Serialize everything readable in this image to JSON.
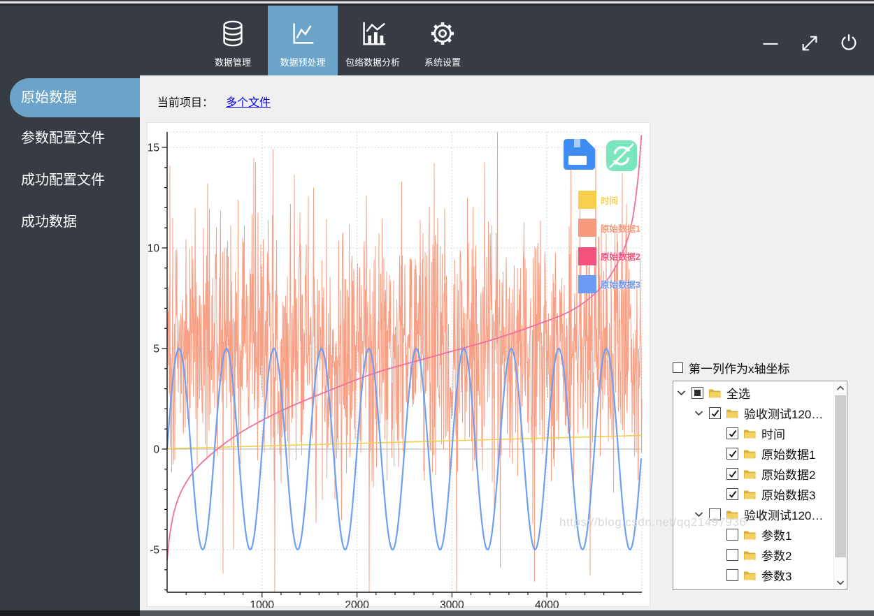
{
  "toolbar": {
    "tabs": [
      {
        "label": "数据管理",
        "selected": false
      },
      {
        "label": "数据预处理",
        "selected": true
      },
      {
        "label": "包络数据分析",
        "selected": false
      },
      {
        "label": "系统设置",
        "selected": false
      }
    ],
    "selected_color": "#6ca3c9"
  },
  "sidebar": {
    "items": [
      {
        "label": "原始数据",
        "selected": true
      },
      {
        "label": "参数配置文件",
        "selected": false
      },
      {
        "label": "成功配置文件",
        "selected": false
      },
      {
        "label": "成功数据",
        "selected": false
      }
    ]
  },
  "main": {
    "project_label": "当前项目：",
    "project_link": "多个文件"
  },
  "right_panel": {
    "checkbox_label": "第一列作为x轴坐标",
    "checkbox_checked": false,
    "tree": [
      {
        "level": 0,
        "expander": true,
        "state": "partial",
        "label": "全选"
      },
      {
        "level": 1,
        "expander": true,
        "state": "checked",
        "label": "验收测试120…"
      },
      {
        "level": 2,
        "expander": false,
        "state": "checked",
        "label": "时间"
      },
      {
        "level": 2,
        "expander": false,
        "state": "checked",
        "label": "原始数据1"
      },
      {
        "level": 2,
        "expander": false,
        "state": "checked",
        "label": "原始数据2"
      },
      {
        "level": 2,
        "expander": false,
        "state": "checked",
        "label": "原始数据3"
      },
      {
        "level": 1,
        "expander": true,
        "state": "unchecked",
        "label": "验收测试120…"
      },
      {
        "level": 2,
        "expander": false,
        "state": "unchecked",
        "label": "参数1"
      },
      {
        "level": 2,
        "expander": false,
        "state": "unchecked",
        "label": "参数2"
      },
      {
        "level": 2,
        "expander": false,
        "state": "unchecked",
        "label": "参数3"
      },
      {
        "level": 2,
        "expander": false,
        "state": "unchecked",
        "label": ""
      }
    ]
  },
  "watermark": "https://blog.csdn.net/qq21497936",
  "colors": {
    "accent_blue": "#6ca3c9",
    "dark_chrome": "#363b44",
    "link": "#0000ee",
    "save_icon": "#3f8cf3",
    "refresh_icon": "#79e6bd"
  },
  "chart_data": {
    "type": "line",
    "title": "",
    "xlabel": "",
    "ylabel": "",
    "x_range": [
      0,
      5000
    ],
    "y_view": [
      -7.1,
      15.8
    ],
    "x_ticks": [
      1000,
      2000,
      3000,
      4000
    ],
    "y_ticks": [
      -5,
      0,
      5,
      10,
      15
    ],
    "x_minor_step": 200,
    "y_minor_step": 1,
    "grid": "dotted",
    "legend_position": "top-right-overlay",
    "series": [
      {
        "name": "时间",
        "kind": "line",
        "swatch_color": "#f7cf4d",
        "line_color": "#f2d04b",
        "points": [
          [
            0,
            0.02
          ],
          [
            5000,
            0.68
          ]
        ]
      },
      {
        "name": "原始数据1",
        "kind": "noise",
        "swatch_color": "#f8987c",
        "line_color": "#f89b7f",
        "mean": 5.3,
        "spread": 7.6,
        "clip": [
          -2.3,
          12.9
        ],
        "spikes_up": [
          [
            30,
            14.1
          ],
          [
            426,
            13.2
          ],
          [
            1117,
            14.9
          ],
          [
            1544,
            13.0
          ],
          [
            2100,
            12.6
          ],
          [
            2470,
            13.3
          ],
          [
            3478,
            15.9
          ],
          [
            4514,
            14.9
          ],
          [
            4794,
            13.7
          ]
        ],
        "spikes_down": [
          [
            588,
            -6.2
          ],
          [
            1133,
            -7.3
          ],
          [
            2127,
            -8.7
          ],
          [
            3050,
            -9.6
          ],
          [
            3509,
            -5.9
          ],
          [
            3868,
            -6.6
          ],
          [
            4456,
            -6.3
          ]
        ]
      },
      {
        "name": "原始数据2",
        "kind": "smooth",
        "swatch_color": "#f4517d",
        "line_color": "#ef6f9f",
        "points": [
          [
            0,
            -5.5
          ],
          [
            30,
            -4.2
          ],
          [
            80,
            -3.0
          ],
          [
            160,
            -2.0
          ],
          [
            300,
            -1.0
          ],
          [
            530,
            0.0
          ],
          [
            800,
            0.9
          ],
          [
            1200,
            1.9
          ],
          [
            1700,
            2.9
          ],
          [
            2200,
            3.8
          ],
          [
            2800,
            4.6
          ],
          [
            3400,
            5.4
          ],
          [
            3900,
            6.2
          ],
          [
            4300,
            7.0
          ],
          [
            4600,
            8.2
          ],
          [
            4800,
            9.8
          ],
          [
            4900,
            11.4
          ],
          [
            4960,
            13.5
          ],
          [
            4995,
            15.6
          ]
        ]
      },
      {
        "name": "原始数据3",
        "kind": "sine",
        "swatch_color": "#6d9bf2",
        "line_color": "#6f9ff0",
        "amplitude": 5,
        "period": 500,
        "phase_deg": 0
      }
    ]
  }
}
